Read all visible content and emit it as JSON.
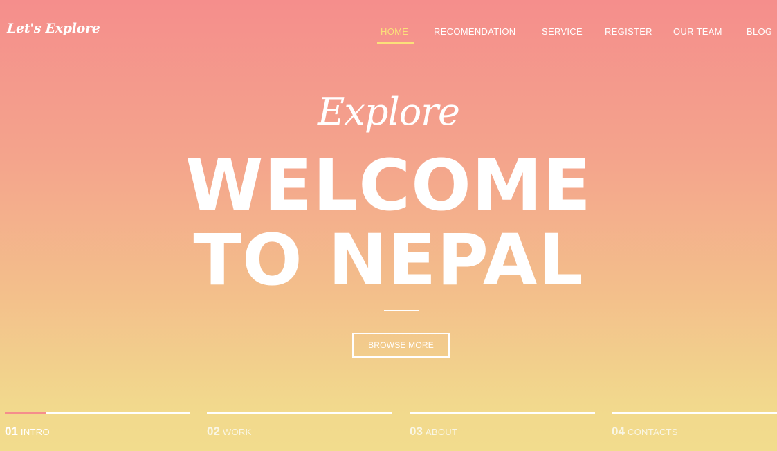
{
  "brand": {
    "logo": "Let's Explore"
  },
  "nav": {
    "items": [
      {
        "label": "HOME",
        "active": true
      },
      {
        "label": "RECOMENDATION",
        "active": false
      },
      {
        "label": "SERVICE",
        "active": false
      },
      {
        "label": "REGISTER",
        "active": false
      },
      {
        "label": "OUR TEAM",
        "active": false
      },
      {
        "label": "BLOG",
        "active": false
      }
    ]
  },
  "hero": {
    "script": "Explore",
    "line1": "WELCOME",
    "line2": "TO NEPAL",
    "button": "BROWSE MORE"
  },
  "sections": [
    {
      "num": "01",
      "label": "INTRO",
      "active": true
    },
    {
      "num": "02",
      "label": "WORK",
      "active": false
    },
    {
      "num": "03",
      "label": "ABOUT",
      "active": false
    },
    {
      "num": "04",
      "label": "CONTACTS",
      "active": false
    }
  ],
  "colors": {
    "gradient_top": "#f58e8c",
    "gradient_bottom": "#f2dc8d",
    "active_nav": "#fbe07a",
    "progress": "#f58e8c"
  }
}
